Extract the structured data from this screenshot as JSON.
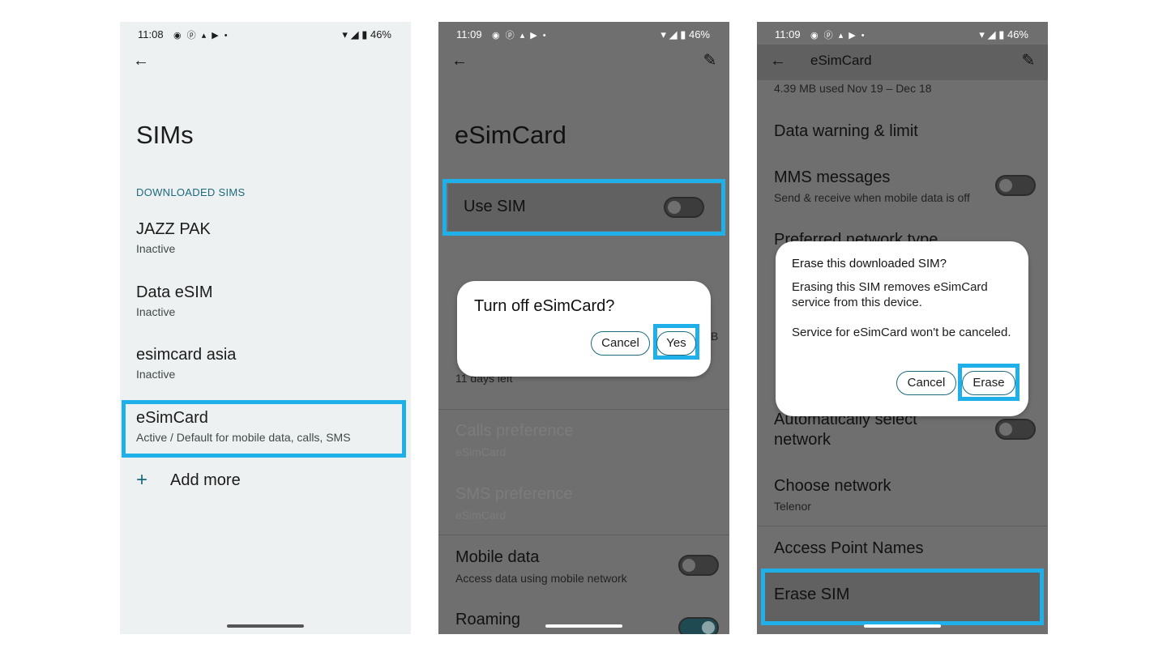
{
  "panel1": {
    "status": {
      "time": "11:08",
      "battery": "46%"
    },
    "title": "SIMs",
    "section_header": "DOWNLOADED SIMS",
    "sims": [
      {
        "name": "JAZZ PAK",
        "status": "Inactive"
      },
      {
        "name": "Data eSIM",
        "status": "Inactive"
      },
      {
        "name": "esimcard asia",
        "status": "Inactive"
      },
      {
        "name": "eSimCard",
        "status": "Active / Default for mobile data, calls, SMS"
      }
    ],
    "add_more_label": "Add more",
    "add_more_icon": "+"
  },
  "panel2": {
    "status": {
      "time": "11:09",
      "battery": "46%"
    },
    "title": "eSimCard",
    "use_sim_label": "Use SIM",
    "use_sim_on": false,
    "partial_under_dialog": "11 days left",
    "partial_right": "B",
    "calls_pref": {
      "title": "Calls preference",
      "value": "eSimCard"
    },
    "sms_pref": {
      "title": "SMS preference",
      "value": "eSimCard"
    },
    "mobile_data": {
      "title": "Mobile data",
      "sub": "Access data using mobile network",
      "on": false
    },
    "roaming": {
      "title": "Roaming",
      "on": true
    },
    "dialog": {
      "title": "Turn off eSimCard?",
      "cancel": "Cancel",
      "confirm": "Yes"
    }
  },
  "panel3": {
    "status": {
      "time": "11:09",
      "battery": "46%"
    },
    "appbar_title": "eSimCard",
    "usage": "4.39 MB used Nov 19 – Dec 18",
    "data_warning": "Data warning & limit",
    "mms": {
      "title": "MMS messages",
      "sub": "Send & receive when mobile data is off",
      "on": false
    },
    "preferred_network": "Preferred network type",
    "auto_select": {
      "title_line1": "Automatically select",
      "title_line2": "network",
      "on": false
    },
    "choose_network": {
      "title": "Choose network",
      "sub": "Telenor"
    },
    "apn": "Access Point Names",
    "erase_sim": "Erase SIM",
    "dialog": {
      "title": "Erase this downloaded SIM?",
      "body1": "Erasing this SIM removes eSimCard service from this device.",
      "body2": "Service for eSimCard won't be canceled.",
      "cancel": "Cancel",
      "confirm": "Erase"
    }
  },
  "colors": {
    "highlight": "#1fb0ea",
    "accent": "#1c6a7e"
  },
  "icons": {
    "back": "arrow-back-icon",
    "edit": "pencil-icon",
    "wifi": "wifi-icon",
    "battery": "battery-icon"
  }
}
